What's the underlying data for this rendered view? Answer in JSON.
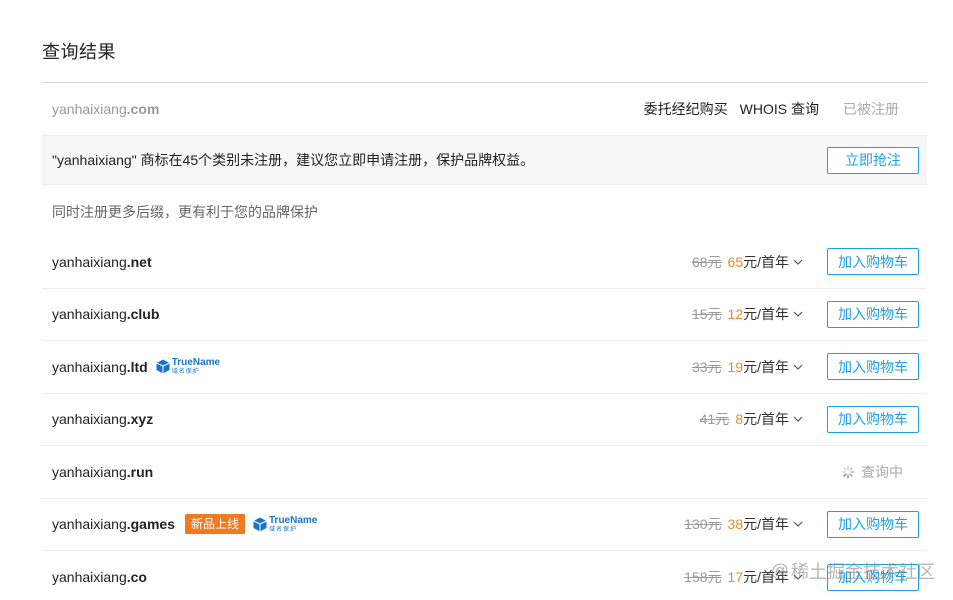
{
  "page": {
    "title": "查询结果",
    "subtitle": "同时注册更多后缀，更有利于您的品牌保护"
  },
  "main_domain": {
    "name": "yanhaixiang",
    "tld": ".com",
    "action_broker": "委托经纪购买",
    "action_whois": "WHOIS 查询",
    "status": "已被注册"
  },
  "notice": {
    "text": "\"yanhaixiang\" 商标在45个类别未注册，建议您立即申请注册，保护品牌权益。",
    "button": "立即抢注"
  },
  "badges": {
    "new_label": "新品上线",
    "truename_main": "TrueName",
    "truename_sub": "域名保护"
  },
  "querying_label": "查询中",
  "cart_button": "加入购物车",
  "unit_label": "元/首年",
  "domains": [
    {
      "name": "yanhaixiang",
      "tld": ".net",
      "old": "68元",
      "new": "65"
    },
    {
      "name": "yanhaixiang",
      "tld": ".club",
      "old": "15元",
      "new": "12"
    },
    {
      "name": "yanhaixiang",
      "tld": ".ltd",
      "old": "33元",
      "new": "19"
    },
    {
      "name": "yanhaixiang",
      "tld": ".xyz",
      "old": "41元",
      "new": "8"
    },
    {
      "name": "yanhaixiang",
      "tld": ".run"
    },
    {
      "name": "yanhaixiang",
      "tld": ".games",
      "old": "130元",
      "new": "38"
    },
    {
      "name": "yanhaixiang",
      "tld": ".co",
      "old": "158元",
      "new": "17"
    }
  ],
  "watermark": {
    "at": "@",
    "text": "稀土掘金技术社区"
  },
  "colors": {
    "accent": "#1ea0e5",
    "price_new": "#f08a24",
    "badge_new": "#f07a22",
    "truename": "#1a73c8"
  }
}
